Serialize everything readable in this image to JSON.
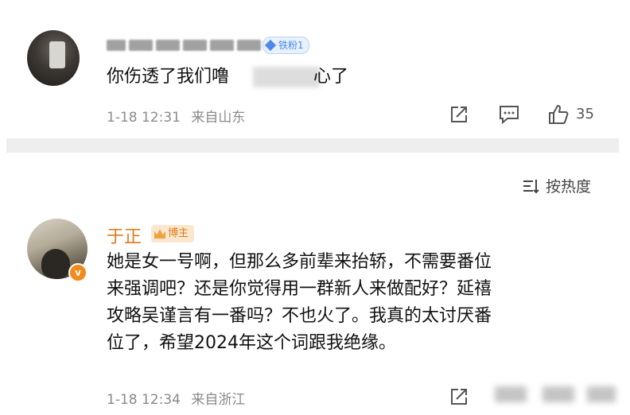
{
  "comment1": {
    "content_visible_start": "你伤透了我们噜",
    "content_visible_end": "心了",
    "fan_badge": "铁粉1",
    "time": "1-18 12:31",
    "location": "来自山东",
    "likes": "35"
  },
  "sort_label": "按热度",
  "comment2": {
    "author": "于正",
    "author_badge": "博主",
    "verified_badge": "v",
    "content_lines": [
      "她是女一号啊，但那么多前辈来抬轿，不需要番位",
      "来强调吧？还是你觉得用一群新人来做配好？延禧",
      "攻略吴谨言有一番吗？不也火了。我真的太讨厌番",
      "位了，希望2024年这个词跟我绝缘。"
    ],
    "time": "1-18 12:34",
    "location": "来自浙江"
  },
  "icons": {
    "share": "share-icon",
    "comment": "comment-icon",
    "like": "thumbs-up-icon",
    "sort": "sort-icon"
  },
  "colors": {
    "author_orange": "#e07a1a",
    "fan_blue": "#4d8ae8",
    "divider_gray": "#eeeeee"
  }
}
